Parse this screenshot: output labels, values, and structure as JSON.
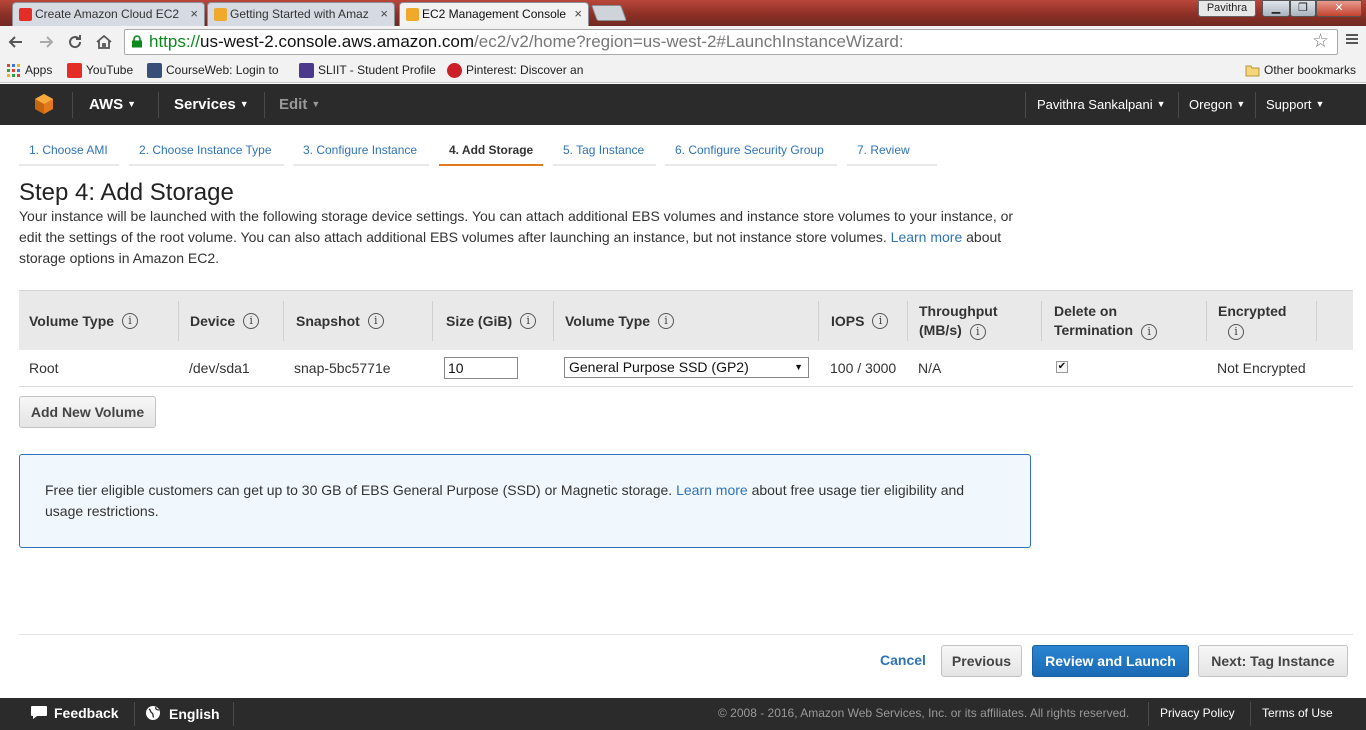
{
  "browser": {
    "tabs": [
      {
        "title": "Create Amazon Cloud EC2",
        "close": "×"
      },
      {
        "title": "Getting Started with Amaz",
        "close": "×"
      },
      {
        "title": "EC2 Management Console",
        "close": "×"
      }
    ],
    "profile_name": "Pavithra",
    "window_buttons": {
      "minimize": "▁",
      "maximize": "❐",
      "close": "✕"
    },
    "url": {
      "scheme": "https://",
      "host": "us-west-2.console.aws.amazon.com",
      "path": "/ec2/v2/home?region=us-west-2#LaunchInstanceWizard:"
    },
    "bookmarks": [
      {
        "label": "Apps"
      },
      {
        "label": "YouTube"
      },
      {
        "label": "CourseWeb: Login to"
      },
      {
        "label": "SLIIT - Student Profile"
      },
      {
        "label": "Pinterest: Discover an"
      }
    ],
    "other_bookmarks": "Other bookmarks"
  },
  "aws_nav": {
    "aws": "AWS",
    "services": "Services",
    "edit": "Edit",
    "user": "Pavithra Sankalpani",
    "region": "Oregon",
    "support": "Support"
  },
  "wizard_tabs": [
    {
      "label": "1. Choose AMI"
    },
    {
      "label": "2. Choose Instance Type"
    },
    {
      "label": "3. Configure Instance"
    },
    {
      "label": "4. Add Storage"
    },
    {
      "label": "5. Tag Instance"
    },
    {
      "label": "6. Configure Security Group"
    },
    {
      "label": "7. Review"
    }
  ],
  "page": {
    "title": "Step 4: Add Storage",
    "desc_part1": "Your instance will be launched with the following storage device settings. You can attach additional EBS volumes and instance store volumes to your instance, or edit the settings of the root volume. You can also attach additional EBS volumes after launching an instance, but not instance store volumes.",
    "learn_more": "Learn more",
    "desc_part2": "about storage options in Amazon EC2."
  },
  "table": {
    "headers": {
      "volume_type": "Volume Type",
      "device": "Device",
      "snapshot": "Snapshot",
      "size": "Size (GiB)",
      "volume_type2": "Volume Type",
      "iops": "IOPS",
      "throughput": "Throughput (MB/s)",
      "delete_on_termination": "Delete on Termination",
      "encrypted": "Encrypted"
    },
    "row": {
      "volume_type": "Root",
      "device": "/dev/sda1",
      "snapshot": "snap-5bc5771e",
      "size": "10",
      "volume_type_select": "General Purpose SSD (GP2)",
      "iops": "100 / 3000",
      "throughput": "N/A",
      "delete_on_termination": true,
      "encrypted": "Not Encrypted"
    }
  },
  "add_volume_label": "Add New Volume",
  "info_box": {
    "text1": "Free tier eligible customers can get up to 30 GB of EBS General Purpose (SSD) or Magnetic storage.",
    "learn_more": "Learn more",
    "text2": "about free usage tier eligibility and usage restrictions."
  },
  "actions": {
    "cancel": "Cancel",
    "previous": "Previous",
    "review_launch": "Review and Launch",
    "next": "Next: Tag Instance"
  },
  "footer": {
    "feedback": "Feedback",
    "language": "English",
    "copyright": "© 2008 - 2016, Amazon Web Services, Inc. or its affiliates. All rights reserved.",
    "privacy": "Privacy Policy",
    "terms": "Terms of Use"
  },
  "colors": {
    "aws_orange": "#e3791b",
    "link_blue": "#2e73b8",
    "primary_button": "#1a6ab5",
    "nav_bg": "#2b2b2b"
  }
}
